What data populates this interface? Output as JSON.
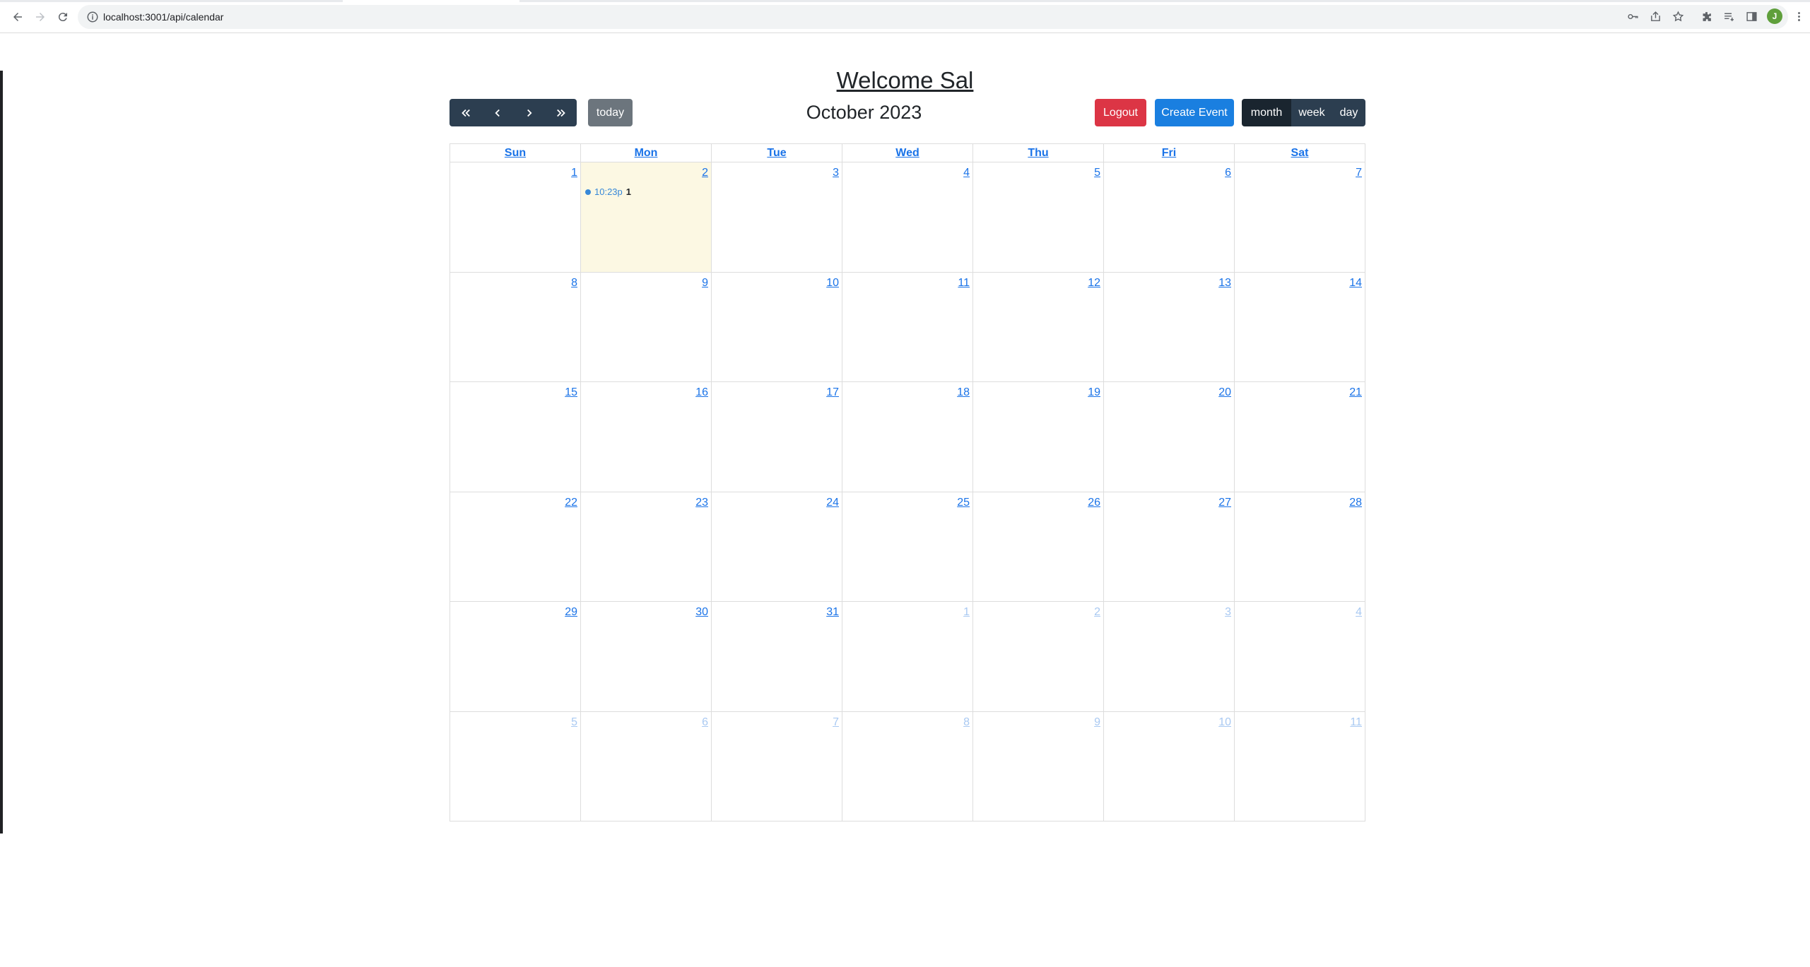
{
  "browser": {
    "url": "localhost:3001/api/calendar",
    "avatar_letter": "J"
  },
  "page": {
    "welcome": "Welcome Sal"
  },
  "toolbar": {
    "today_label": "today",
    "title": "October 2023",
    "logout_label": "Logout",
    "create_label": "Create Event",
    "views": [
      "month",
      "week",
      "day"
    ],
    "active_view": "month"
  },
  "calendar": {
    "day_headers": [
      "Sun",
      "Mon",
      "Tue",
      "Wed",
      "Thu",
      "Fri",
      "Sat"
    ],
    "today": {
      "week": 0,
      "day": 1
    },
    "weeks": [
      [
        {
          "n": "1"
        },
        {
          "n": "2"
        },
        {
          "n": "3"
        },
        {
          "n": "4"
        },
        {
          "n": "5"
        },
        {
          "n": "6"
        },
        {
          "n": "7"
        }
      ],
      [
        {
          "n": "8"
        },
        {
          "n": "9"
        },
        {
          "n": "10"
        },
        {
          "n": "11"
        },
        {
          "n": "12"
        },
        {
          "n": "13"
        },
        {
          "n": "14"
        }
      ],
      [
        {
          "n": "15"
        },
        {
          "n": "16"
        },
        {
          "n": "17"
        },
        {
          "n": "18"
        },
        {
          "n": "19"
        },
        {
          "n": "20"
        },
        {
          "n": "21"
        }
      ],
      [
        {
          "n": "22"
        },
        {
          "n": "23"
        },
        {
          "n": "24"
        },
        {
          "n": "25"
        },
        {
          "n": "26"
        },
        {
          "n": "27"
        },
        {
          "n": "28"
        }
      ],
      [
        {
          "n": "29"
        },
        {
          "n": "30"
        },
        {
          "n": "31"
        },
        {
          "n": "1",
          "other": true
        },
        {
          "n": "2",
          "other": true
        },
        {
          "n": "3",
          "other": true
        },
        {
          "n": "4",
          "other": true
        }
      ],
      [
        {
          "n": "5",
          "other": true
        },
        {
          "n": "6",
          "other": true
        },
        {
          "n": "7",
          "other": true
        },
        {
          "n": "8",
          "other": true
        },
        {
          "n": "9",
          "other": true
        },
        {
          "n": "10",
          "other": true
        },
        {
          "n": "11",
          "other": true
        }
      ]
    ],
    "events": [
      {
        "week": 0,
        "day": 1,
        "time": "10:23p",
        "title": "1"
      }
    ]
  },
  "colors": {
    "nav_button": "#2c3e50",
    "today_button": "#6c757d",
    "logout_button": "#dc3545",
    "create_button": "#1a7fe0",
    "today_highlight": "#fcf8e3",
    "link": "#1a73e8",
    "event_dot": "#3788d8"
  }
}
